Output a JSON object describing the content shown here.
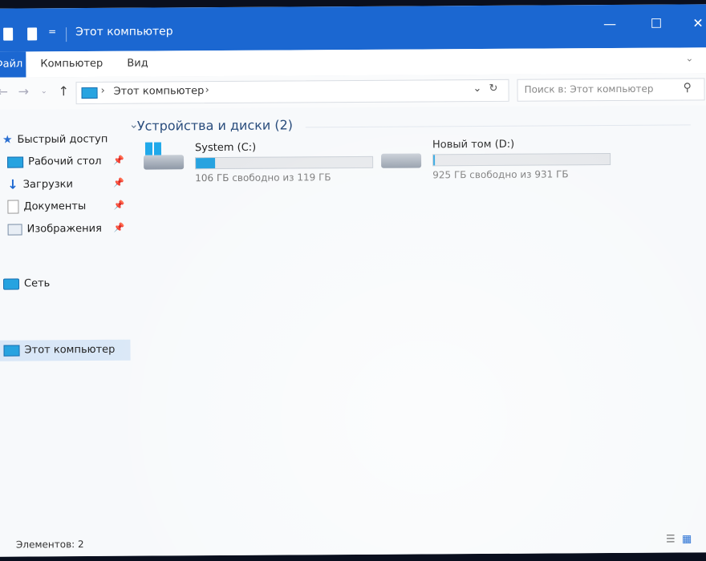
{
  "window": {
    "title": "Этот компьютер",
    "controls": [
      "—",
      "☐",
      "✕"
    ]
  },
  "ribbon": {
    "file_tab": "Файл",
    "tabs": [
      "Компьютер",
      "Вид"
    ]
  },
  "navigation": {
    "address_path": "Этот компьютер",
    "search_placeholder": "Поиск в: Этот компьютер"
  },
  "sidebar": {
    "items": [
      {
        "label": "Быстрый доступ",
        "icon": "star-icon",
        "pinned": false
      },
      {
        "label": "Рабочий стол",
        "icon": "desktop-icon",
        "pinned": true
      },
      {
        "label": "Загрузки",
        "icon": "download-icon",
        "pinned": true
      },
      {
        "label": "Документы",
        "icon": "document-icon",
        "pinned": true
      },
      {
        "label": "Изображения",
        "icon": "pictures-icon",
        "pinned": true
      },
      {
        "label": "Этот компьютер",
        "icon": "computer-icon",
        "pinned": false,
        "selected": true
      },
      {
        "label": "Сеть",
        "icon": "network-icon",
        "pinned": false
      }
    ]
  },
  "content": {
    "group_title": "Устройства и диски (2)",
    "drives": [
      {
        "name": "System (C:)",
        "free": "106 ГБ свободно из 119 ГБ",
        "used_fraction": 0.11,
        "icon": "windows-drive-icon"
      },
      {
        "name": "Новый том (D:)",
        "free": "925 ГБ свободно из 931 ГБ",
        "used_fraction": 0.006,
        "icon": "drive-icon"
      }
    ]
  },
  "status": {
    "items_count": "Элементов: 2"
  },
  "colors": {
    "titlebar": "#1b67d1",
    "progress": "#27a3e0",
    "selection": "#d9e7f7"
  }
}
